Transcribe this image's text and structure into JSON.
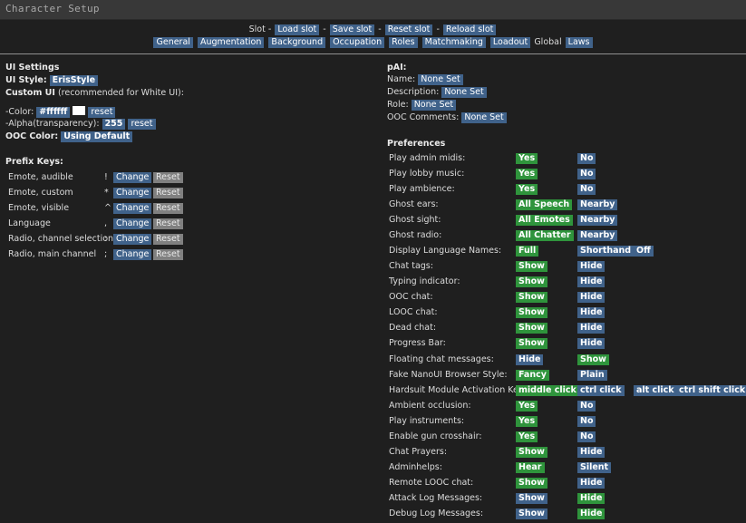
{
  "window": {
    "title": "Character Setup"
  },
  "slot_bar": {
    "prefix": "Slot -",
    "load": "Load slot",
    "dash1": "-",
    "save": "Save slot",
    "dash2": "-",
    "reset": "Reset slot",
    "dash3": "-",
    "reload": "Reload slot"
  },
  "tabs": {
    "general": "General",
    "augmentation": "Augmentation",
    "background": "Background",
    "occupation": "Occupation",
    "roles": "Roles",
    "matchmaking": "Matchmaking",
    "loadout": "Loadout",
    "global": "Global",
    "laws": "Laws"
  },
  "ui_settings": {
    "heading": "UI Settings",
    "style_label": "UI Style:",
    "style_value": "ErisStyle",
    "custom_label": "Custom UI",
    "custom_note": "(recommended for White UI):",
    "color_label": "-Color:",
    "color_value": "#ffffff",
    "color_reset": "reset",
    "alpha_label": "-Alpha(transparency):",
    "alpha_value": "255",
    "alpha_reset": "reset",
    "ooc_color_label": "OOC Color:",
    "ooc_color_value": "Using Default",
    "swatch_color": "#ffffff"
  },
  "prefix_keys": {
    "heading": "Prefix Keys:",
    "change_label": "Change",
    "reset_label": "Reset",
    "rows": [
      {
        "name": "Emote, audible",
        "key": "!"
      },
      {
        "name": "Emote, custom",
        "key": "*"
      },
      {
        "name": "Emote, visible",
        "key": "^"
      },
      {
        "name": "Language",
        "key": ","
      },
      {
        "name": "Radio, channel selection",
        "key": ":"
      },
      {
        "name": "Radio, main channel",
        "key": ";"
      }
    ]
  },
  "pai": {
    "heading": "pAI:",
    "name_label": "Name:",
    "name_value": "None Set",
    "desc_label": "Description:",
    "desc_value": "None Set",
    "role_label": "Role:",
    "role_value": "None Set",
    "ooc_label": "OOC Comments:",
    "ooc_value": "None Set"
  },
  "preferences": {
    "heading": "Preferences",
    "rows": [
      {
        "label": "Play admin midis:",
        "opts": [
          "Yes",
          "No"
        ],
        "sel": 0
      },
      {
        "label": "Play lobby music:",
        "opts": [
          "Yes",
          "No"
        ],
        "sel": 0
      },
      {
        "label": "Play ambience:",
        "opts": [
          "Yes",
          "No"
        ],
        "sel": 0
      },
      {
        "label": "Ghost ears:",
        "opts": [
          "All Speech",
          "Nearby"
        ],
        "sel": 0
      },
      {
        "label": "Ghost sight:",
        "opts": [
          "All Emotes",
          "Nearby"
        ],
        "sel": 0
      },
      {
        "label": "Ghost radio:",
        "opts": [
          "All Chatter",
          "Nearby"
        ],
        "sel": 0
      },
      {
        "label": "Display Language Names:",
        "opts": [
          "Full",
          "Shorthand",
          "Off"
        ],
        "sel": 0
      },
      {
        "label": "Chat tags:",
        "opts": [
          "Show",
          "Hide"
        ],
        "sel": 0
      },
      {
        "label": "Typing indicator:",
        "opts": [
          "Show",
          "Hide"
        ],
        "sel": 0
      },
      {
        "label": "OOC chat:",
        "opts": [
          "Show",
          "Hide"
        ],
        "sel": 0
      },
      {
        "label": "LOOC chat:",
        "opts": [
          "Show",
          "Hide"
        ],
        "sel": 0
      },
      {
        "label": "Dead chat:",
        "opts": [
          "Show",
          "Hide"
        ],
        "sel": 0
      },
      {
        "label": "Progress Bar:",
        "opts": [
          "Show",
          "Hide"
        ],
        "sel": 0
      },
      {
        "label": "Floating chat messages:",
        "opts": [
          "Hide",
          "Show"
        ],
        "sel": 1
      },
      {
        "label": "Fake NanoUI Browser Style:",
        "opts": [
          "Fancy",
          "Plain"
        ],
        "sel": 0
      },
      {
        "label": "Hardsuit Module Activation Key:",
        "opts": [
          "middle click",
          "ctrl click",
          "alt click",
          "ctrl shift click"
        ],
        "sel": 0
      },
      {
        "label": "Ambient occlusion:",
        "opts": [
          "Yes",
          "No"
        ],
        "sel": 0
      },
      {
        "label": "Play instruments:",
        "opts": [
          "Yes",
          "No"
        ],
        "sel": 0
      },
      {
        "label": "Enable gun crosshair:",
        "opts": [
          "Yes",
          "No"
        ],
        "sel": 0
      },
      {
        "label": "Chat Prayers:",
        "opts": [
          "Show",
          "Hide"
        ],
        "sel": 0
      },
      {
        "label": "Adminhelps:",
        "opts": [
          "Hear",
          "Silent"
        ],
        "sel": 0
      },
      {
        "label": "Remote LOOC chat:",
        "opts": [
          "Show",
          "Hide"
        ],
        "sel": 0
      },
      {
        "label": "Attack Log Messages:",
        "opts": [
          "Show",
          "Hide"
        ],
        "sel": 1
      },
      {
        "label": "Debug Log Messages:",
        "opts": [
          "Show",
          "Hide"
        ],
        "sel": 1
      }
    ]
  },
  "colors": {
    "selected": "#2f943c",
    "unselected": "#40628a",
    "reset_grey": "#808080"
  }
}
